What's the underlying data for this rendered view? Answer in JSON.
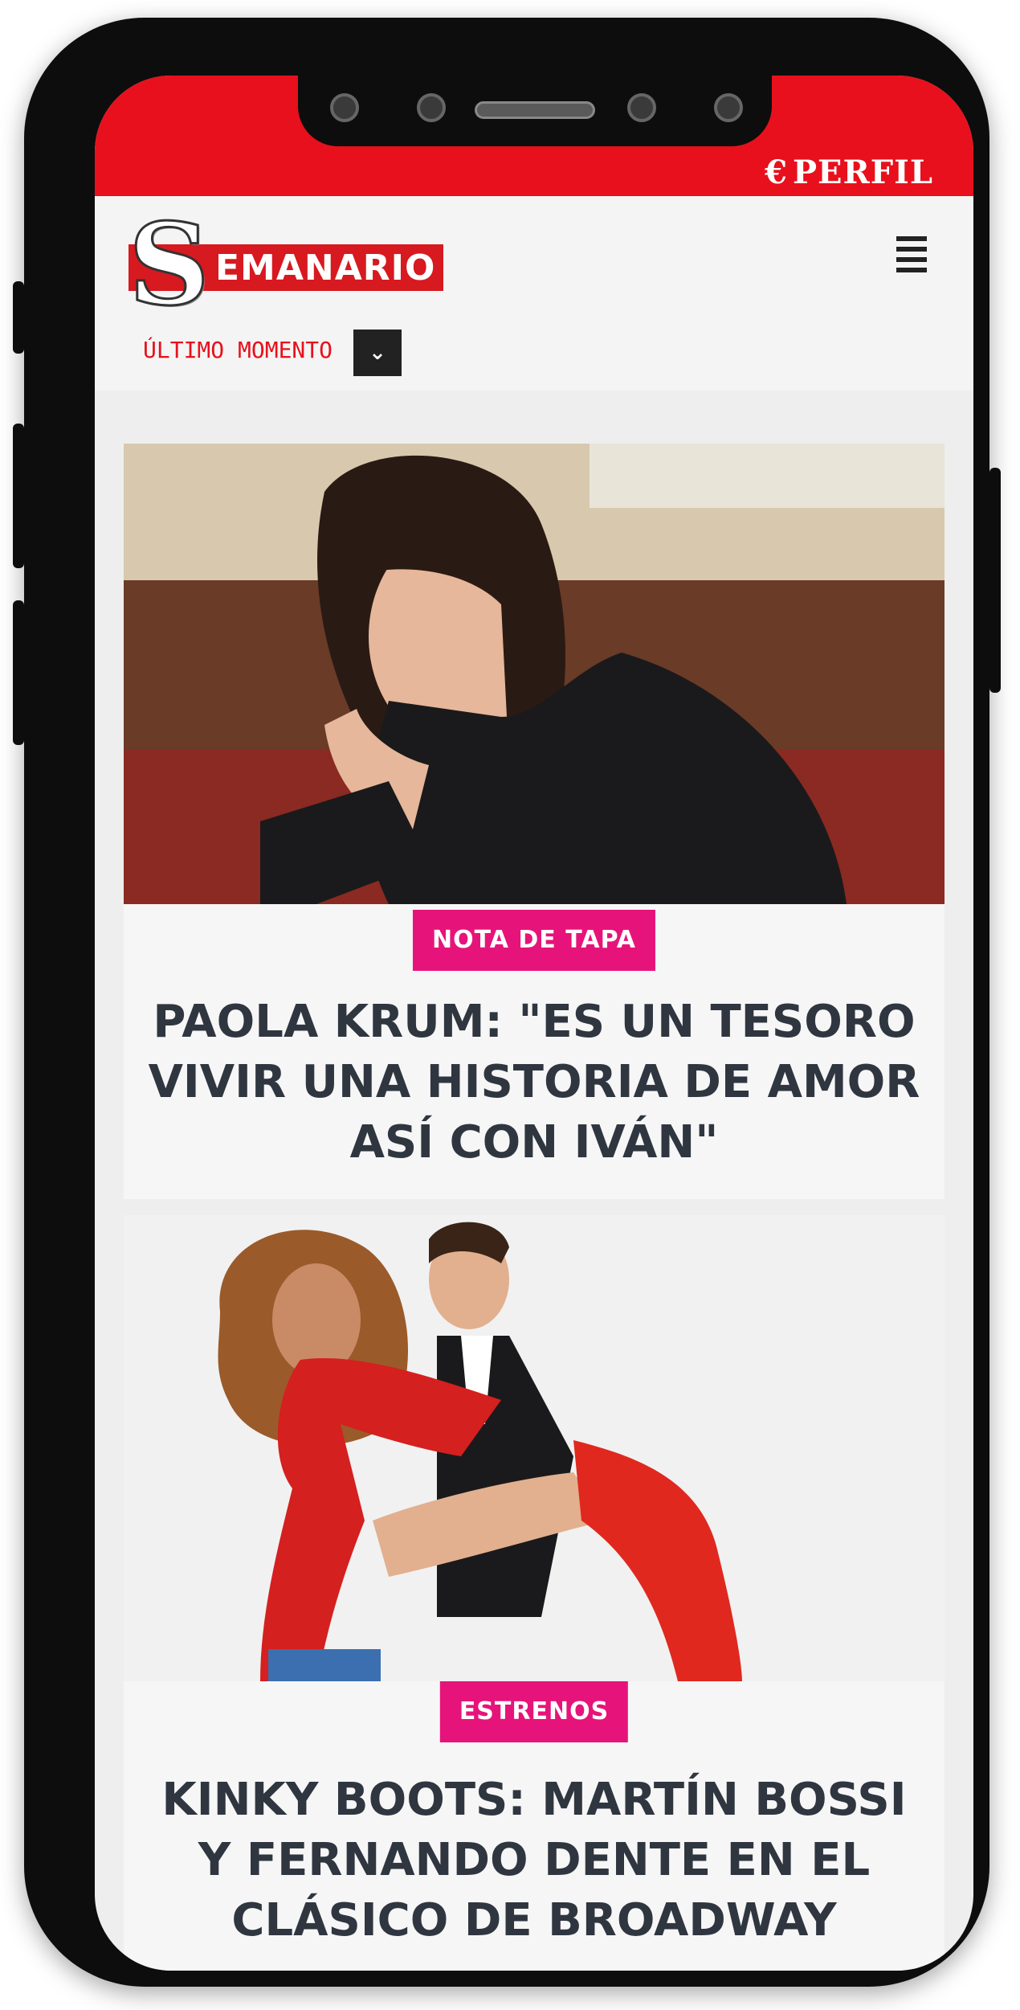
{
  "header": {
    "brand_top": "PERFIL",
    "logo_letter": "S",
    "logo_text": "EMANARIO",
    "ultimo_momento": "ÚLTIMO MOMENTO"
  },
  "articles": [
    {
      "tag": "NOTA DE TAPA",
      "headline": "PAOLA KRUM: \"ES UN TESORO VIVIR UNA HISTORIA DE AMOR ASÍ CON IVÁN\""
    },
    {
      "tag": "ESTRENOS",
      "headline": "KINKY BOOTS: MARTÍN BOSSI Y FERNANDO DENTE EN EL CLÁSICO DE BROADWAY"
    }
  ],
  "colors": {
    "accent_red": "#e8101c",
    "tag_pink": "#e6147a",
    "headline": "#2f3640"
  }
}
